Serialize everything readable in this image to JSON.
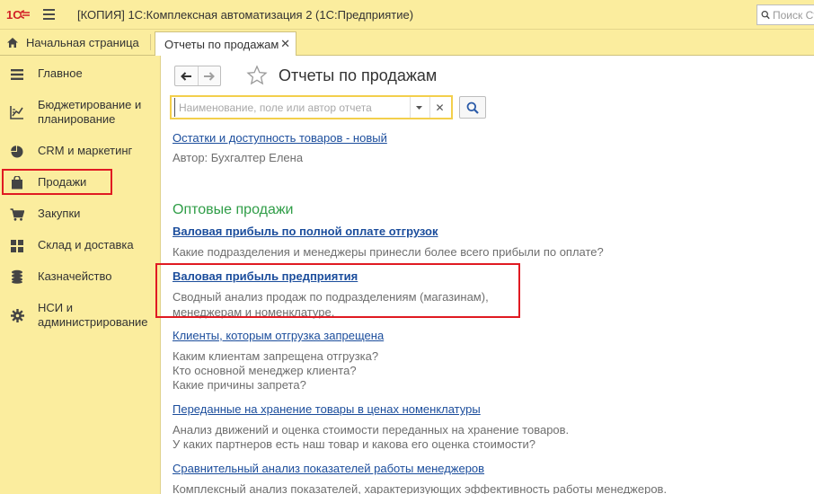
{
  "window": {
    "title": "[КОПИЯ] 1С:Комплексная автоматизация 2  (1С:Предприятие)",
    "search_placeholder": "Поиск Ct"
  },
  "tabs": {
    "home_label": "Начальная страница",
    "active_label": "Отчеты по продажам"
  },
  "sidebar": {
    "items": [
      {
        "label": "Главное",
        "icon": "menu-lines-icon"
      },
      {
        "label": "Бюджетирование и",
        "label2": "планирование",
        "icon": "chart-icon"
      },
      {
        "label": "CRM и маркетинг",
        "icon": "pie-chart-icon"
      },
      {
        "label": "Продажи",
        "icon": "shopping-bag-icon"
      },
      {
        "label": "Закупки",
        "icon": "cart-icon"
      },
      {
        "label": "Склад и доставка",
        "icon": "grid-icon"
      },
      {
        "label": "Казначейство",
        "icon": "coins-icon"
      },
      {
        "label": "НСИ и",
        "label2": "администрирование",
        "icon": "gear-icon"
      }
    ]
  },
  "content": {
    "page_title": "Отчеты по продажам",
    "filter_placeholder": "Наименование, поле или автор отчета",
    "reports": {
      "r1": {
        "title": "Остатки и доступность товаров - новый",
        "desc": "Автор: Бухгалтер Елена"
      },
      "section": "Оптовые продажи",
      "r2": {
        "title": "Валовая прибыль по полной оплате отгрузок",
        "desc": "Какие подразделения и менеджеры принесли более всего прибыли по оплате?"
      },
      "r3": {
        "title": "Валовая прибыль предприятия",
        "desc1": "Сводный анализ продаж по подразделениям (магазинам),",
        "desc2": "менеджерам и номенклатуре."
      },
      "r4": {
        "title": "Клиенты, которым отгрузка запрещена",
        "desc1": "Каким клиентам запрещена отгрузка?",
        "desc2": "Кто основной менеджер клиента?",
        "desc3": "Какие причины запрета?"
      },
      "r5": {
        "title": "Переданные на хранение товары в ценах номенклатуры",
        "desc1": "Анализ движений и оценка стоимости переданных на хранение товаров.",
        "desc2": "У каких партнеров есть наш товар и какова его оценка стоимости?"
      },
      "r6": {
        "title": "Сравнительный анализ показателей работы менеджеров",
        "desc": "Комплексный анализ показателей, характеризующих эффективность работы менеджеров."
      }
    }
  },
  "colors": {
    "panel": "#fbed9e",
    "link": "#1b4d9c",
    "section": "#2f9d47",
    "highlight": "#e01a22"
  }
}
